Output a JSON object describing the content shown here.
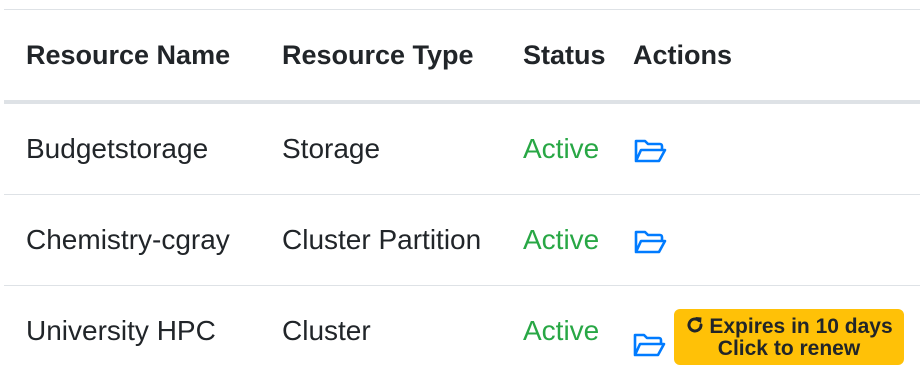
{
  "table": {
    "headers": {
      "name": "Resource Name",
      "type": "Resource Type",
      "status": "Status",
      "actions": "Actions"
    },
    "rows": [
      {
        "name": "Budgetstorage",
        "type": "Storage",
        "status": "Active",
        "action_icon": "folder-open-icon"
      },
      {
        "name": "Chemistry-cgray",
        "type": "Cluster Partition",
        "status": "Active",
        "action_icon": "folder-open-icon"
      },
      {
        "name": "University HPC",
        "type": "Cluster",
        "status": "Active",
        "action_icon": "folder-open-icon"
      }
    ]
  },
  "renew_badge": {
    "line1": "Expires in 10 days",
    "line2": "Click to renew",
    "icon": "refresh-icon",
    "color": "#ffc107"
  },
  "colors": {
    "status_active": "#28a745",
    "icon_blue": "#007bff",
    "border": "#dee2e6"
  }
}
